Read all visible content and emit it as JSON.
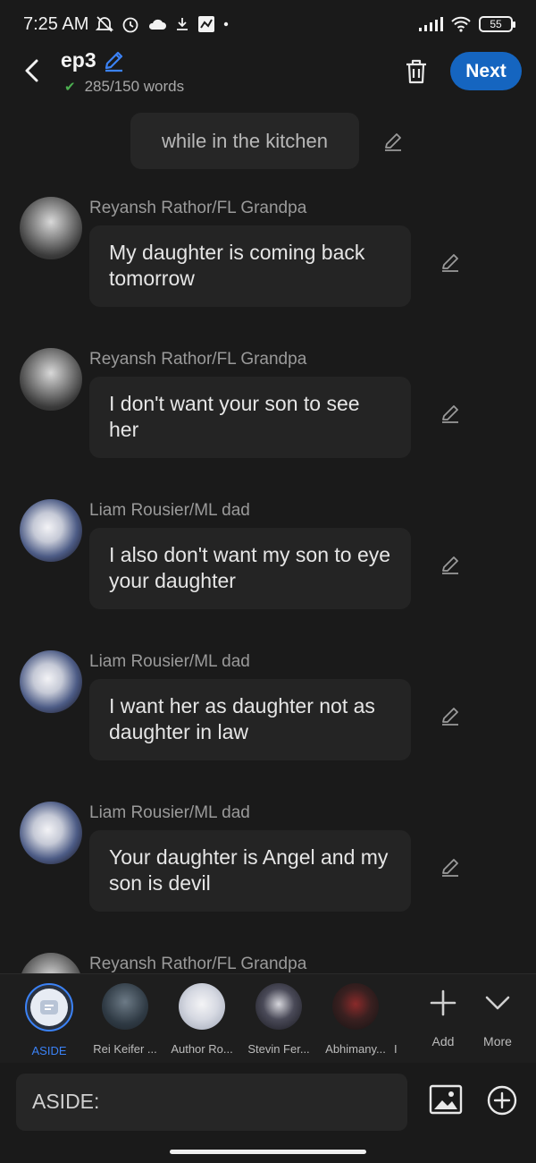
{
  "status_bar": {
    "time": "7:25 AM",
    "battery": "55",
    "icons": [
      "mute-icon",
      "alarm-icon",
      "cloud-icon",
      "download-icon",
      "app-icon",
      "dot-icon",
      "signal-icon",
      "wifi-icon",
      "battery-icon"
    ]
  },
  "header": {
    "title": "ep3",
    "word_count": "285/150 words",
    "next_label": "Next"
  },
  "chat": {
    "narration": "while in the kitchen",
    "messages": [
      {
        "sender": "Reyansh Rathor/FL Grandpa",
        "text": "My daughter is coming back tomorrow"
      },
      {
        "sender": "Reyansh Rathor/FL Grandpa",
        "text": "I don't want your son to see her"
      },
      {
        "sender": "Liam Rousier/ML dad",
        "text": "I also don't want my son to eye your daughter"
      },
      {
        "sender": "Liam Rousier/ML dad",
        "text": "I want her as daughter not as daughter in law"
      },
      {
        "sender": "Liam Rousier/ML dad",
        "text": "Your daughter is Angel and my son is devil"
      },
      {
        "sender": "Reyansh Rathor/FL Grandpa",
        "text": ""
      }
    ]
  },
  "characters": {
    "items": [
      {
        "label": "ASIDE"
      },
      {
        "label": "Rei Keifer ..."
      },
      {
        "label": "Author Ro..."
      },
      {
        "label": "Stevin Fer..."
      },
      {
        "label": "Abhimany..."
      },
      {
        "label": "I"
      }
    ],
    "add_label": "Add",
    "more_label": "More"
  },
  "composer": {
    "placeholder": "ASIDE:"
  },
  "colors": {
    "accent": "#1565c0",
    "aside_blue": "#3b82f6",
    "background": "#1a1a1a",
    "bubble": "#242424"
  }
}
